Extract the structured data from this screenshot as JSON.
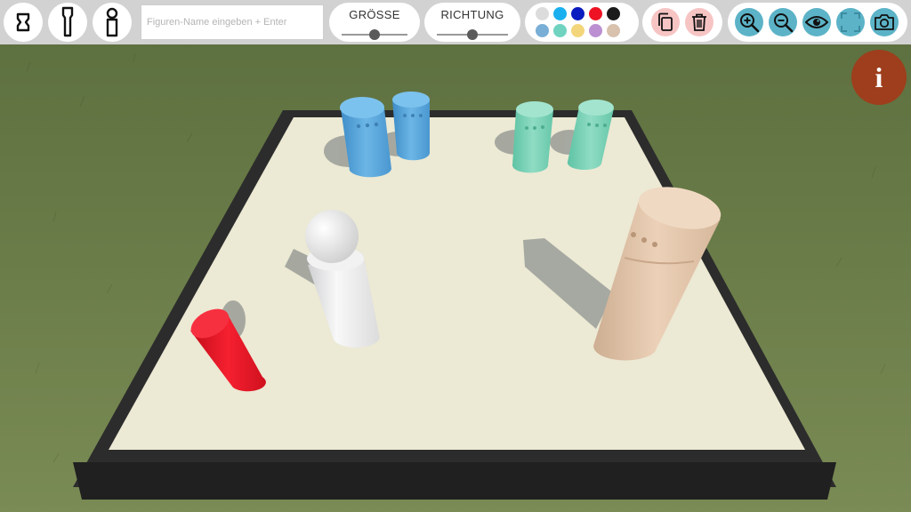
{
  "toolbar": {
    "figure_buttons": [
      {
        "icon": "small-figure-icon"
      },
      {
        "icon": "tall-figure-icon"
      },
      {
        "icon": "pawn-figure-icon"
      }
    ],
    "name_input": {
      "value": "",
      "placeholder": "Figuren-Name eingeben + Enter"
    },
    "size_slider": {
      "label": "GRÖSSE",
      "level": 0.5
    },
    "direction_slider": {
      "label": "RICHTUNG",
      "level": 0.5
    },
    "colors": [
      "#dcdcdc",
      "#1ab0ef",
      "#0a1bbf",
      "#ee1324",
      "#1b1b1b",
      "#79aed6",
      "#6fd3c0",
      "#f3d67b",
      "#bb8fd2",
      "#d8c1ad"
    ],
    "edit_buttons": [
      {
        "icon": "copy-icon",
        "color": "#f7c4c4"
      },
      {
        "icon": "trash-icon",
        "color": "#f7c4c4"
      }
    ],
    "view_buttons": [
      {
        "icon": "zoom-in-icon",
        "color": "#5cb3c7"
      },
      {
        "icon": "zoom-out-icon",
        "color": "#5cb3c7"
      },
      {
        "icon": "eye-icon",
        "color": "#5cb3c7"
      },
      {
        "icon": "fullscreen-icon",
        "color": "#5cb3c7"
      },
      {
        "icon": "camera-icon",
        "color": "#5cb3c7"
      }
    ]
  },
  "info_button": {
    "label": "i",
    "color": "#9e3e1c"
  },
  "scene": {
    "figures": [
      {
        "name": "blue-figure-1",
        "color": "#5aa7dc"
      },
      {
        "name": "blue-figure-2",
        "color": "#5aa7dc"
      },
      {
        "name": "teal-figure-1",
        "color": "#7ed6bb"
      },
      {
        "name": "teal-figure-2",
        "color": "#7ed6bb"
      },
      {
        "name": "white-figure",
        "color": "#f0f0f0"
      },
      {
        "name": "red-figure",
        "color": "#ee1324"
      },
      {
        "name": "beige-figure",
        "color": "#e6c8ad"
      }
    ]
  }
}
